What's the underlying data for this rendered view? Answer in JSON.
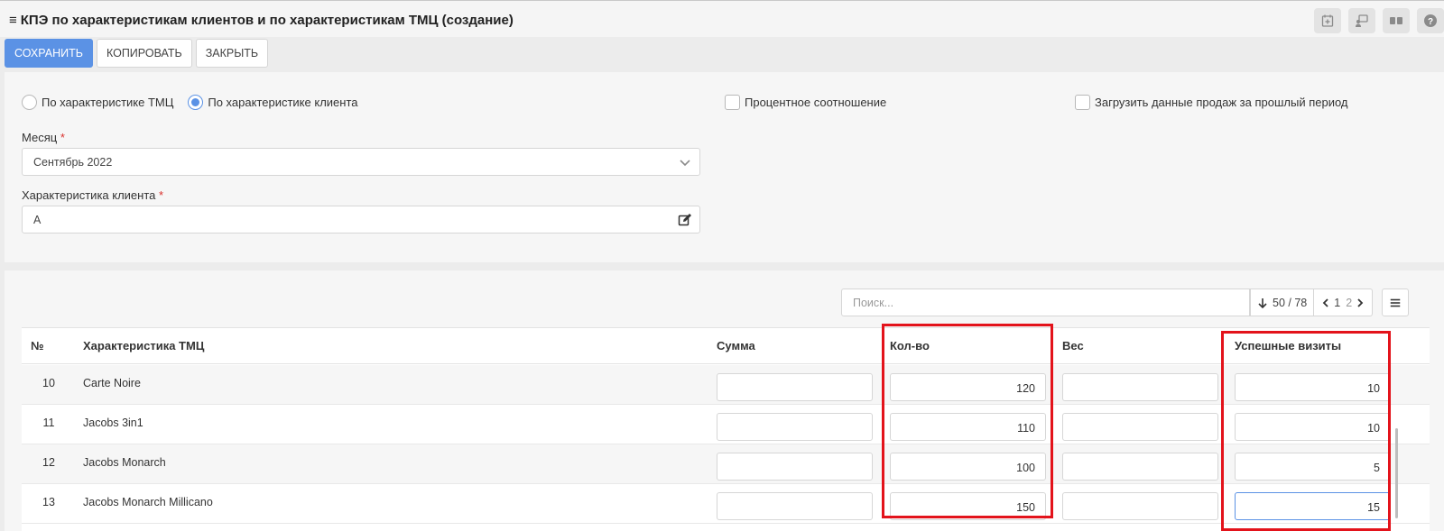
{
  "header": {
    "title": "КПЭ по характеристикам клиентов и по характеристикам ТМЦ (создание)",
    "menu_icon": "hamburger-icon",
    "icons": [
      "calendar-add-icon",
      "user-screen-icon",
      "cards-icon",
      "help-icon"
    ]
  },
  "toolbar": {
    "save_label": "СОХРАНИТЬ",
    "copy_label": "КОПИРОВАТЬ",
    "close_label": "ЗАКРЫТЬ"
  },
  "form": {
    "radio_tmc": "По характеристике ТМЦ",
    "radio_client": "По характеристике клиента",
    "selected_radio": "client",
    "check_percent": "Процентное соотношение",
    "check_load_sales": "Загрузить данные продаж за прошлый период",
    "month_label": "Месяц",
    "month_value": "Сентябрь 2022",
    "client_char_label": "Характеристика клиента",
    "client_char_value": "А",
    "required_mark": "*"
  },
  "table_tools": {
    "search_placeholder": "Поиск...",
    "count": "50 / 78",
    "page_current": "1",
    "page_next": "2"
  },
  "table": {
    "columns": {
      "num": "№",
      "char": "Характеристика ТМЦ",
      "sum": "Сумма",
      "qty": "Кол-во",
      "weight": "Вес",
      "visits": "Успешные визиты"
    },
    "rows": [
      {
        "num": "10",
        "name": "Carte Noire",
        "sum": "",
        "qty": "120",
        "weight": "",
        "visits": "10"
      },
      {
        "num": "11",
        "name": "Jacobs 3in1",
        "sum": "",
        "qty": "110",
        "weight": "",
        "visits": "10"
      },
      {
        "num": "12",
        "name": "Jacobs Monarch",
        "sum": "",
        "qty": "100",
        "weight": "",
        "visits": "5"
      },
      {
        "num": "13",
        "name": "Jacobs Monarch Millicano",
        "sum": "",
        "qty": "150",
        "weight": "",
        "visits": "15"
      }
    ]
  },
  "colors": {
    "primary": "#5b92e5",
    "highlight": "#e3131b",
    "required": "#d9302c"
  }
}
